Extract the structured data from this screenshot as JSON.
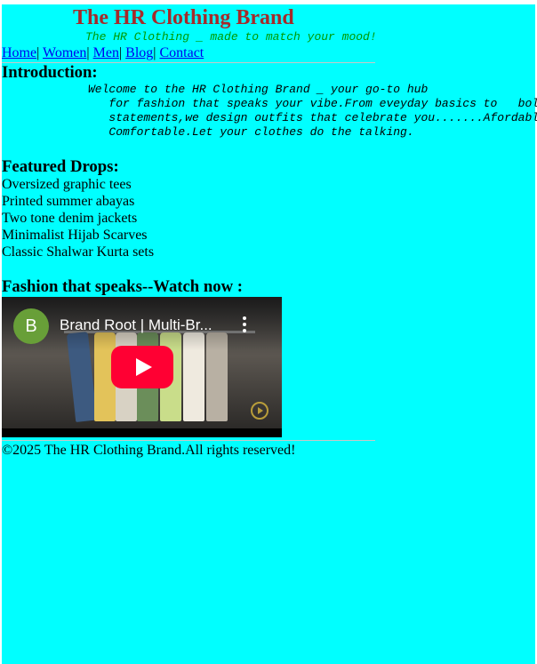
{
  "header": {
    "title": "The HR Clothing Brand",
    "tagline": "The HR Clothing _ made to match your mood!"
  },
  "nav": {
    "items": [
      "Home",
      "Women",
      "Men",
      "Blog",
      "Contact"
    ],
    "separator": "|"
  },
  "intro": {
    "heading": "Introduction:",
    "text": "Welcome to the HR Clothing Brand _ your go-to hub\n   for fashion that speaks your vibe.From eveyday basics to   bold\n   statements,we design outfits that celebrate you.......Afordable,\n   Comfortable.Let your clothes do the talking."
  },
  "featured": {
    "heading": "Featured Drops:",
    "items": [
      "Oversized graphic tees",
      "Printed summer abayas",
      "Two tone denim jackets",
      "Minimalist Hijab Scarves",
      "Classic Shalwar Kurta sets"
    ]
  },
  "video": {
    "heading": "Fashion that speaks--Watch now :",
    "channel_initial": "B",
    "title": "Brand Root | Multi-Br...",
    "channel_color": "#689f38",
    "play_color": "#ff0033"
  },
  "footer": {
    "text": "©2025 The HR Clothing Brand.All rights reserved!"
  },
  "colors": {
    "page_background": "#00ffff",
    "title": "#a52a2a",
    "tagline": "#009900",
    "link": "#0000ee"
  }
}
